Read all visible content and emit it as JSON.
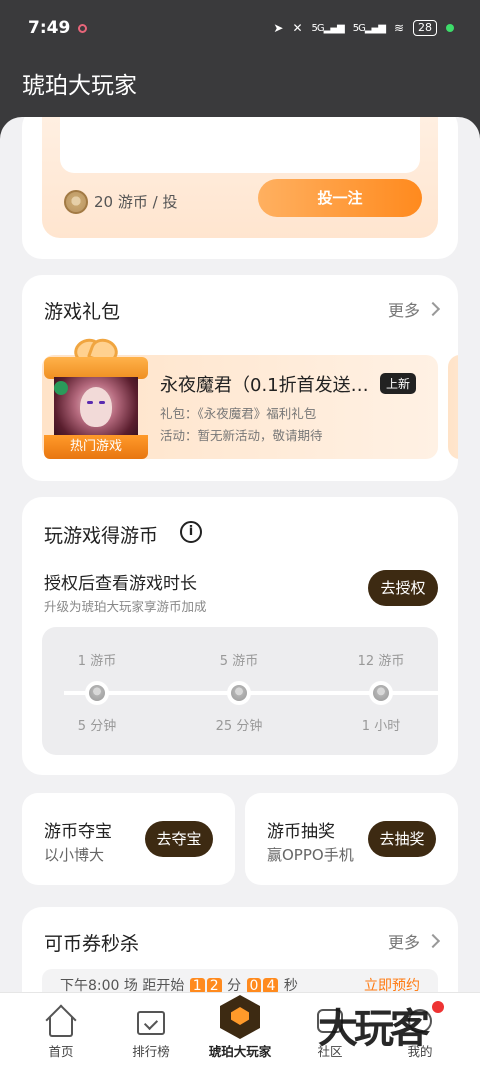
{
  "status_bar": {
    "time": "7:49",
    "battery": "28",
    "network_1": "5G",
    "network_2": "5G"
  },
  "app_title": "琥珀大玩家",
  "bet": {
    "price": "20 游币 / 投",
    "button": "投一注"
  },
  "gift_section": {
    "title": "游戏礼包",
    "more": "更多",
    "item": {
      "name": "永夜魔君（0.1折首发送…",
      "badge": "上新",
      "gift_line": "礼包：《永夜魔君》福利礼包",
      "activity_line": "活动：暂无新活动，敬请期待",
      "hot_label": "热门游戏"
    }
  },
  "play_section": {
    "title": "玩游戏得游币",
    "auth_title": "授权后查看游戏时长",
    "auth_sub": "升级为琥珀大玩家享游币加成",
    "auth_button": "去授权",
    "tiers": [
      {
        "coins": "1 游币",
        "time": "5 分钟"
      },
      {
        "coins": "5 游币",
        "time": "25 分钟"
      },
      {
        "coins": "12 游币",
        "time": "1 小时"
      }
    ]
  },
  "treasure": {
    "title": "游币夺宝",
    "sub": "以小博大",
    "button": "去夺宝"
  },
  "lottery": {
    "title": "游币抽奖",
    "sub": "赢OPPO手机",
    "button": "去抽奖"
  },
  "flash_section": {
    "title": "可币券秒杀",
    "more": "更多",
    "strip_prefix": "下午8:00 场 距开始",
    "d1": "1",
    "d2": "2",
    "unit1": "分",
    "d3": "0",
    "d4": "4",
    "unit2": "秒",
    "reserve": "立即预约"
  },
  "nav": {
    "items": [
      {
        "label": "首页",
        "icon": "home-icon"
      },
      {
        "label": "排行榜",
        "icon": "ranking-icon"
      },
      {
        "label": "琥珀大玩家",
        "icon": "amber-player-icon"
      },
      {
        "label": "社区",
        "icon": "community-icon"
      },
      {
        "label": "我的",
        "icon": "profile-icon"
      }
    ]
  },
  "watermark": "大玩客",
  "colors": {
    "accent": "#ff8a1e",
    "dark_button": "#3d2a12",
    "header_bg": "#3a3a3c"
  }
}
